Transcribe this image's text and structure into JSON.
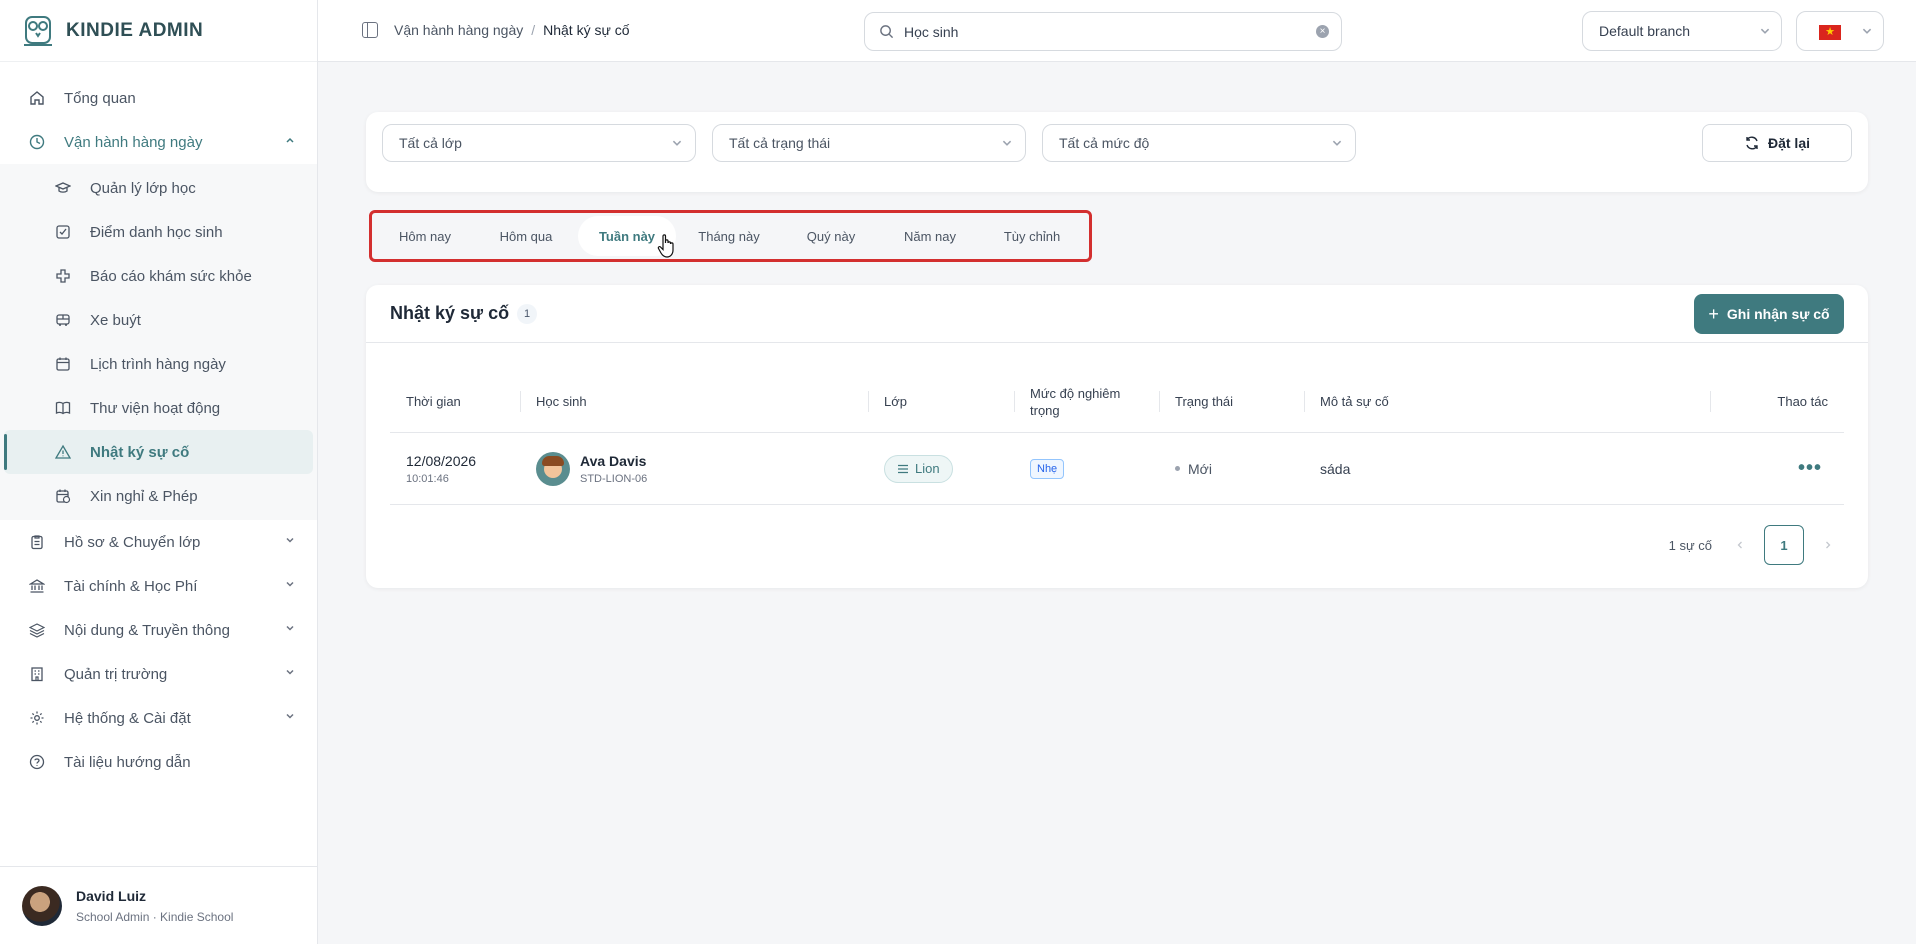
{
  "brand": {
    "name": "KINDIE ADMIN"
  },
  "sidebar": {
    "items": [
      {
        "label": "Tổng quan",
        "icon": "home-icon"
      },
      {
        "label": "Vận hành hàng ngày",
        "icon": "clock-icon",
        "open": true
      },
      {
        "label": "Hồ sơ & Chuyển lớp",
        "icon": "clipboard-icon"
      },
      {
        "label": "Tài chính & Học Phí",
        "icon": "bank-icon"
      },
      {
        "label": "Nội dung & Truyền thông",
        "icon": "layers-icon"
      },
      {
        "label": "Quản trị trường",
        "icon": "building-icon"
      },
      {
        "label": "Hệ thống & Cài đặt",
        "icon": "gear-icon"
      },
      {
        "label": "Tài liệu hướng dẫn",
        "icon": "help-icon"
      }
    ],
    "subitems": [
      {
        "label": "Quản lý lớp học",
        "icon": "graduation-cap-icon"
      },
      {
        "label": "Điểm danh học sinh",
        "icon": "checkbox-icon"
      },
      {
        "label": "Báo cáo khám sức khỏe",
        "icon": "medical-cross-icon"
      },
      {
        "label": "Xe buýt",
        "icon": "bus-icon"
      },
      {
        "label": "Lịch trình hàng ngày",
        "icon": "calendar-icon"
      },
      {
        "label": "Thư viện hoạt động",
        "icon": "book-icon"
      },
      {
        "label": "Nhật ký sự cố",
        "icon": "warning-icon",
        "active": true
      },
      {
        "label": "Xin nghỉ & Phép",
        "icon": "calendar-clock-icon"
      }
    ]
  },
  "user": {
    "name": "David Luiz",
    "role": "School Admin · Kindie School"
  },
  "topbar": {
    "breadcrumb": [
      "Vận hành hàng ngày",
      "Nhật ký sự cố"
    ],
    "breadcrumb_separator": "/",
    "search_value": "Học sinh",
    "branch": "Default branch",
    "flag_glyph": "★"
  },
  "filters": {
    "class": "Tất cả lớp",
    "status": "Tất cả trạng thái",
    "severity": "Tất cả mức độ",
    "reset_label": "Đặt lại"
  },
  "tabs": [
    {
      "label": "Hôm nay"
    },
    {
      "label": "Hôm qua"
    },
    {
      "label": "Tuần này",
      "active": true
    },
    {
      "label": "Tháng này"
    },
    {
      "label": "Quý này"
    },
    {
      "label": "Năm nay"
    },
    {
      "label": "Tùy chỉnh"
    }
  ],
  "incidents": {
    "title": "Nhật ký sự cố",
    "count": "1",
    "add_label": "Ghi nhận sự cố",
    "columns": {
      "time": "Thời gian",
      "student": "Học sinh",
      "class": "Lớp",
      "severity": "Mức độ nghiêm trọng",
      "status": "Trạng thái",
      "description": "Mô tả sự cố",
      "actions": "Thao tác"
    },
    "rows": [
      {
        "date": "12/08/2026",
        "time": "10:01:46",
        "student_name": "Ava Davis",
        "student_code": "STD-LION-06",
        "class": "Lion",
        "severity": "Nhẹ",
        "status": "Mới",
        "description": "sáda",
        "more": "•••"
      }
    ],
    "total_text": "1 sự cố",
    "page": "1"
  },
  "colors": {
    "accent": "#3f7a7f",
    "highlight_border": "#d32f2f"
  }
}
